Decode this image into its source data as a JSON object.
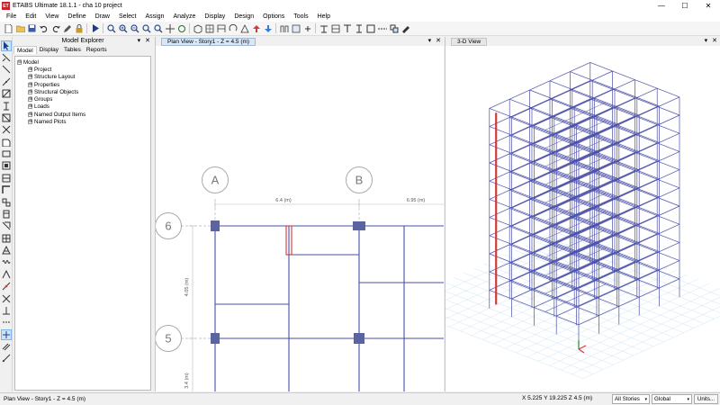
{
  "window": {
    "title": "ETABS Ultimate 18.1.1 - cha 10 project",
    "app_badge": "ET",
    "minimize": "—",
    "maximize": "☐",
    "close": "✕"
  },
  "menu": [
    "File",
    "Edit",
    "View",
    "Define",
    "Draw",
    "Select",
    "Assign",
    "Analyze",
    "Display",
    "Design",
    "Options",
    "Tools",
    "Help"
  ],
  "toolbar_icons": [
    "new-file-icon",
    "open-folder-icon",
    "save-icon",
    "undo-icon",
    "redo-icon",
    "pencil-icon",
    "lock-icon",
    "run-analysis-icon",
    "zoom-window-icon",
    "zoom-in-icon",
    "zoom-out-icon",
    "zoom-fit-icon",
    "zoom-previous-icon",
    "pan-icon",
    "refresh-icon",
    "view-3d-icon",
    "plan-view-icon",
    "elevation-view-icon",
    "rotate-icon",
    "perspective-icon",
    "move-up-icon",
    "move-down-icon",
    "show-undeformed-icon",
    "display-options-icon",
    "object-shrink-icon"
  ],
  "explorer": {
    "title": "Model Explorer",
    "tabs": [
      "Model",
      "Display",
      "Tables",
      "Reports"
    ],
    "active_tab": "Model",
    "root": "Model",
    "items": [
      "Project",
      "Structure Layout",
      "Properties",
      "Structural Objects",
      "Groups",
      "Loads",
      "Named Output Items",
      "Named Plots"
    ],
    "expand_glyph": "⊟",
    "collapsed_glyph": "⊞"
  },
  "plan_view": {
    "tab_label": "Plan View - Story1 - Z = 4.5 (m)",
    "grid_letters": [
      "A",
      "B"
    ],
    "grid_numbers": [
      "6",
      "5"
    ],
    "dim_labels": [
      "6.4 (m)",
      "6.95 (m)",
      "4.05 (m)",
      "3.4 (m)"
    ]
  },
  "view3d": {
    "tab_label": "3-D View"
  },
  "panel_controls": {
    "dropdown": "▾",
    "close": "✕"
  },
  "status": {
    "left": "Plan View - Story1 - Z = 4.5 (m)",
    "coords": "X 5.225  Y 19.225  Z 4.5 (m)",
    "stories": "All Stories",
    "coord_system": "Global",
    "units_button": "Units..."
  },
  "colors": {
    "frame": "#4a4fa8",
    "column": "#5a64a0",
    "highlight": "#d23a3a",
    "grid": "#9a9a9a",
    "bubble": "#a9a9a9"
  }
}
